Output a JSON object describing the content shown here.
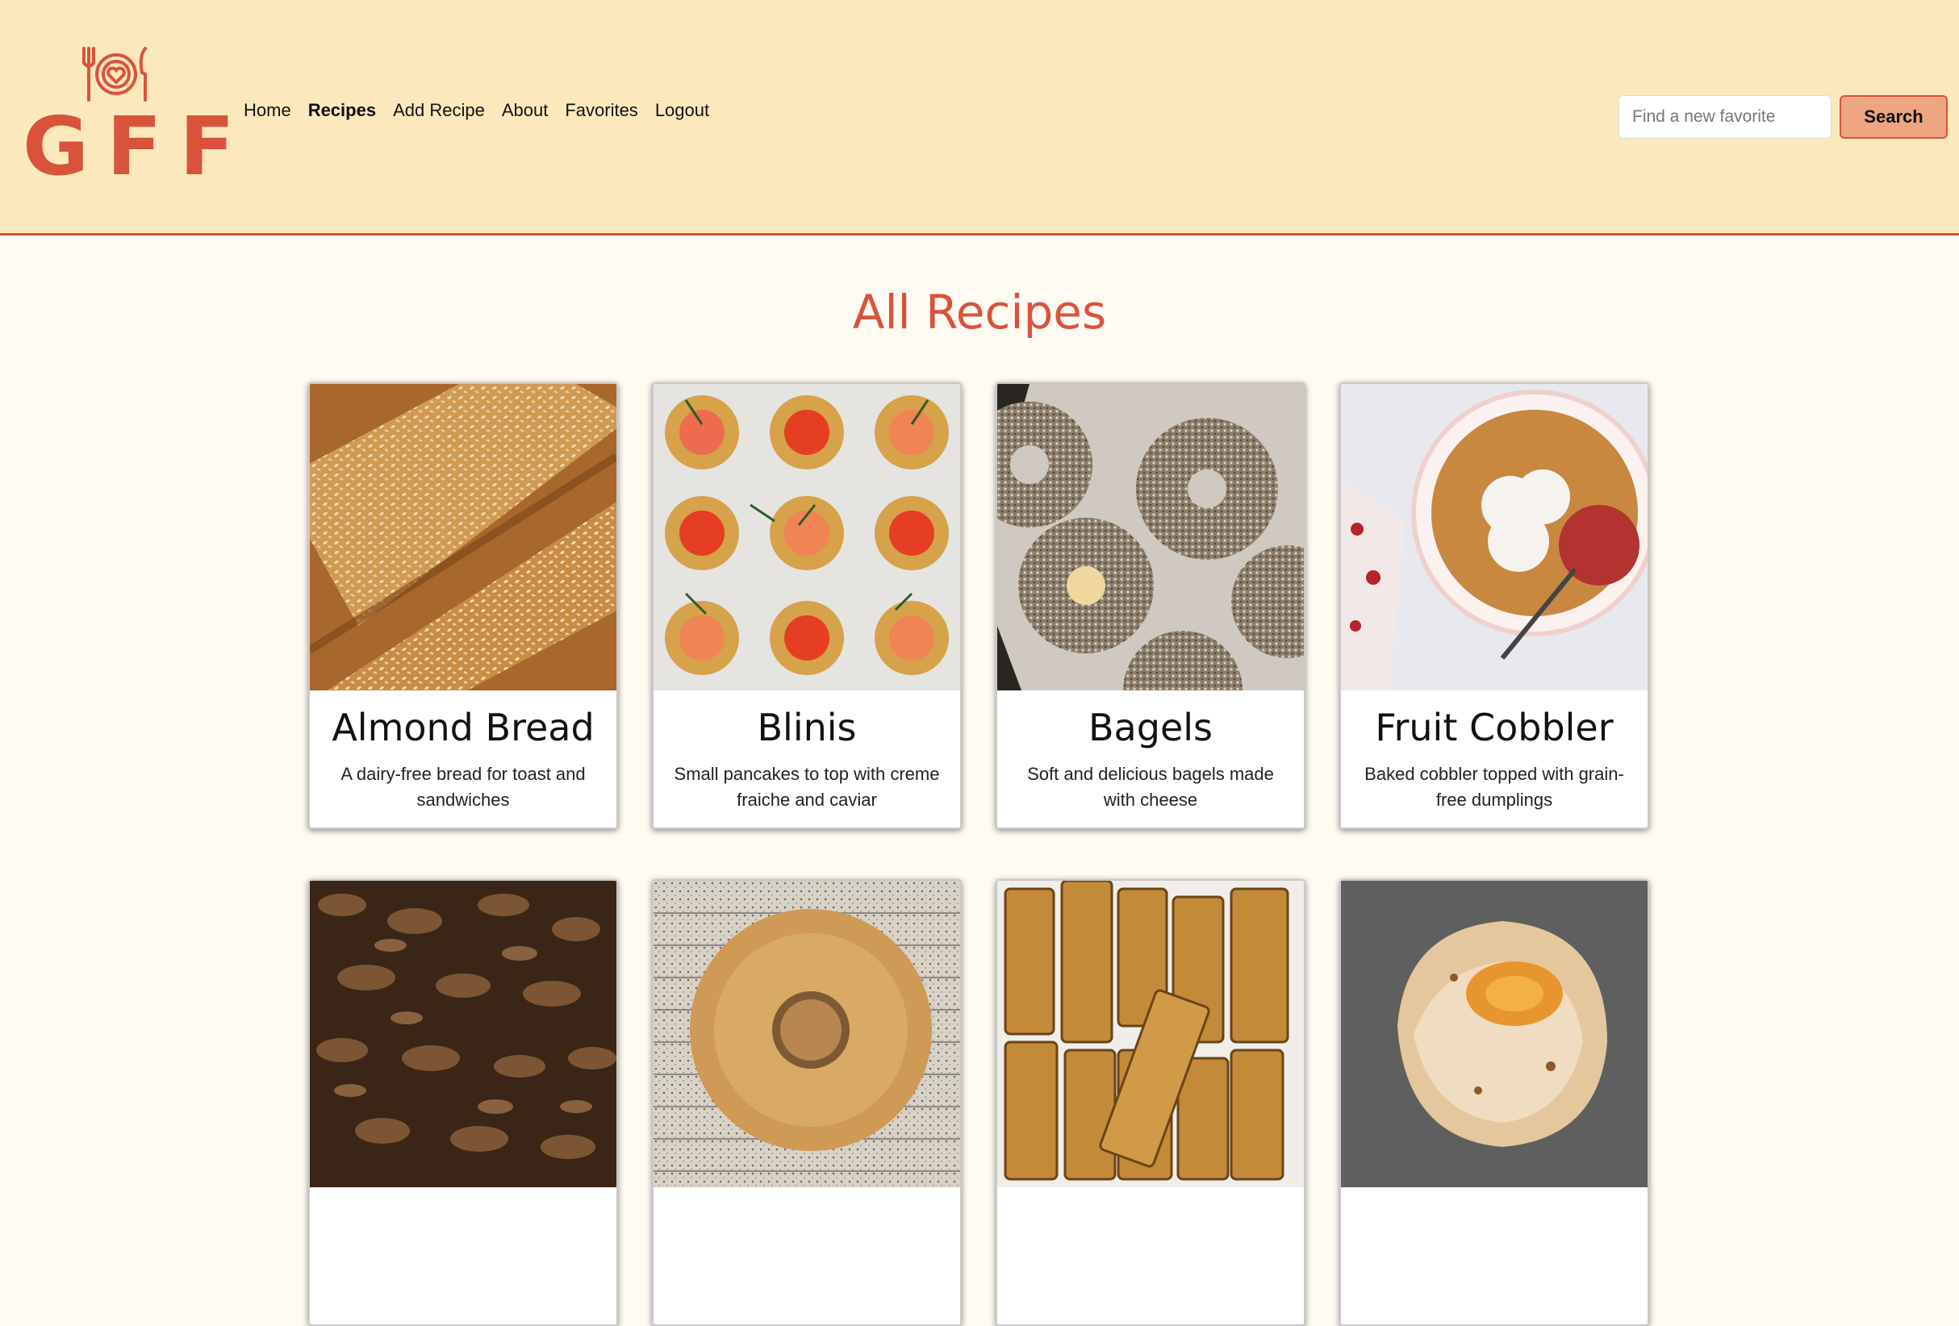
{
  "header": {
    "logo_text": "GFF",
    "nav": [
      {
        "label": "Home",
        "active": false
      },
      {
        "label": "Recipes",
        "active": true
      },
      {
        "label": "Add Recipe",
        "active": false
      },
      {
        "label": "About",
        "active": false
      },
      {
        "label": "Favorites",
        "active": false
      },
      {
        "label": "Logout",
        "active": false
      }
    ],
    "search": {
      "placeholder": "Find a new favorite",
      "value": "",
      "button_label": "Search"
    }
  },
  "main": {
    "title": "All Recipes",
    "recipes": [
      {
        "title": "Almond Bread",
        "description": "A dairy-free bread for toast and sandwiches",
        "image": "almond-bread-photo"
      },
      {
        "title": "Blinis",
        "description": "Small pancakes to top with creme fraiche and caviar",
        "image": "blinis-photo"
      },
      {
        "title": "Bagels",
        "description": "Soft and delicious bagels made with cheese",
        "image": "bagels-photo"
      },
      {
        "title": "Fruit Cobbler",
        "description": "Baked cobbler topped with grain-free dumplings",
        "image": "fruit-cobbler-photo"
      },
      {
        "title": "",
        "description": "",
        "image": "granola-photo"
      },
      {
        "title": "",
        "description": "",
        "image": "bundt-cake-photo"
      },
      {
        "title": "",
        "description": "",
        "image": "crepes-photo"
      },
      {
        "title": "",
        "description": "",
        "image": "galette-photo"
      }
    ]
  },
  "colors": {
    "header_bg": "#fbe9bd",
    "page_bg": "#fffaf2",
    "accent": "#d9533c",
    "search_button_bg": "#eda582"
  }
}
